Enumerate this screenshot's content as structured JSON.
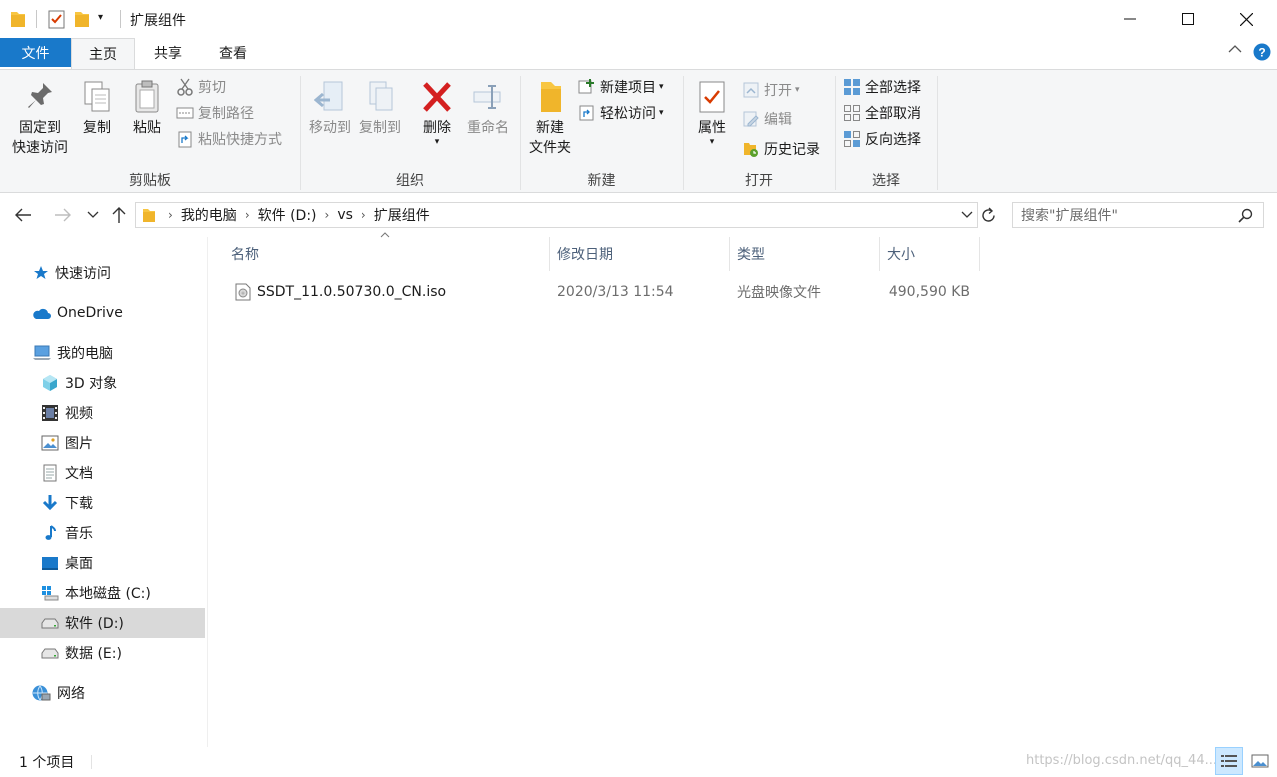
{
  "window": {
    "title": "扩展组件",
    "controls": [
      "minimize",
      "maximize",
      "close"
    ]
  },
  "tabs": [
    {
      "label": "文件"
    },
    {
      "label": "主页"
    },
    {
      "label": "共享"
    },
    {
      "label": "查看"
    }
  ],
  "ribbon": {
    "clipboard": {
      "label": "剪贴板",
      "pin_line1": "固定到",
      "pin_line2": "快速访问",
      "copy": "复制",
      "paste": "粘贴",
      "cut": "剪切",
      "copy_path": "复制路径",
      "paste_shortcut": "粘贴快捷方式"
    },
    "organize": {
      "label": "组织",
      "move_to": "移动到",
      "copy_to": "复制到",
      "delete": "删除",
      "rename": "重命名"
    },
    "new": {
      "label": "新建",
      "new_folder_line1": "新建",
      "new_folder_line2": "文件夹",
      "new_item": "新建项目",
      "easy_access": "轻松访问"
    },
    "open": {
      "label": "打开",
      "properties": "属性",
      "open": "打开",
      "edit": "编辑",
      "history": "历史记录"
    },
    "select": {
      "label": "选择",
      "select_all": "全部选择",
      "select_none": "全部取消",
      "invert": "反向选择"
    }
  },
  "address": {
    "crumbs": [
      "我的电脑",
      "软件 (D:)",
      "vs",
      "扩展组件"
    ],
    "search_placeholder": "搜索\"扩展组件\""
  },
  "sidebar": {
    "items": [
      {
        "label": "快速访问",
        "icon": "star-icon"
      },
      {
        "label": "OneDrive",
        "icon": "cloud-icon"
      },
      {
        "label": "我的电脑",
        "icon": "computer-icon"
      },
      {
        "label": "3D 对象",
        "icon": "cube-icon"
      },
      {
        "label": "视频",
        "icon": "video-icon"
      },
      {
        "label": "图片",
        "icon": "picture-icon"
      },
      {
        "label": "文档",
        "icon": "document-icon"
      },
      {
        "label": "下载",
        "icon": "download-icon"
      },
      {
        "label": "音乐",
        "icon": "music-icon"
      },
      {
        "label": "桌面",
        "icon": "desktop-icon"
      },
      {
        "label": "本地磁盘 (C:)",
        "icon": "windows-drive-icon"
      },
      {
        "label": "软件 (D:)",
        "icon": "drive-icon"
      },
      {
        "label": "数据 (E:)",
        "icon": "drive-icon"
      },
      {
        "label": "网络",
        "icon": "network-icon"
      }
    ],
    "selected": "软件 (D:)"
  },
  "columns": [
    "名称",
    "修改日期",
    "类型",
    "大小"
  ],
  "files": [
    {
      "name": "SSDT_11.0.50730.0_CN.iso",
      "modified": "2020/3/13 11:54",
      "type": "光盘映像文件",
      "size": "490,590 KB",
      "icon": "disc-image-icon"
    }
  ],
  "status": {
    "count": "1 个项目",
    "watermark": "https://blog.csdn.net/qq_44..."
  },
  "colors": {
    "accent": "#1979ca",
    "ribbon_bg": "#f5f6f7",
    "selected_bg": "#d9d9d9",
    "column_header_text": "#4c607a",
    "delete_red": "#d42020",
    "folder_yellow": "#f8c642"
  }
}
